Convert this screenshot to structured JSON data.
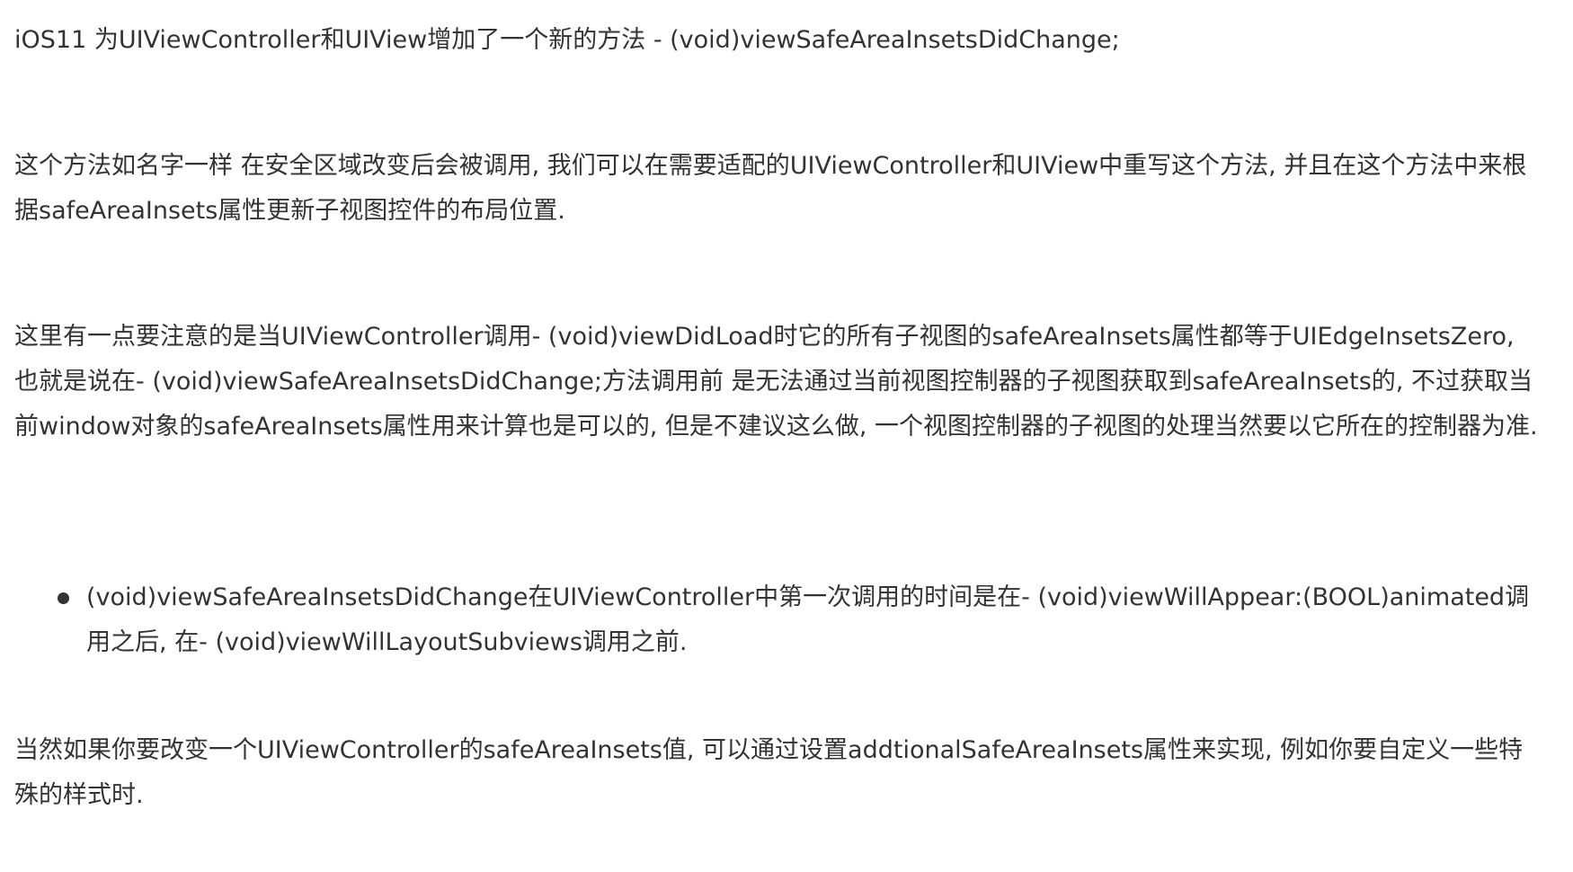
{
  "paragraphs": [
    "iOS11 为UIViewController和UIView增加了一个新的方法 - (void)viewSafeAreaInsetsDidChange;",
    "这个方法如名字一样 在安全区域改变后会被调用, 我们可以在需要适配的UIViewController和UIView中重写这个方法, 并且在这个方法中来根据safeAreaInsets属性更新子视图控件的布局位置.",
    "这里有一点要注意的是当UIViewController调用- (void)viewDidLoad时它的所有子视图的safeAreaInsets属性都等于UIEdgeInsetsZero, 也就是说在- (void)viewSafeAreaInsetsDidChange;方法调用前 是无法通过当前视图控制器的子视图获取到safeAreaInsets的, 不过获取当前window对象的safeAreaInsets属性用来计算也是可以的, 但是不建议这么做, 一个视图控制器的子视图的处理当然要以它所在的控制器为准."
  ],
  "bullets": [
    "(void)viewSafeAreaInsetsDidChange在UIViewController中第一次调用的时间是在- (void)viewWillAppear:(BOOL)animated调用之后, 在- (void)viewWillLayoutSubviews调用之前."
  ],
  "closing_paragraph": "当然如果你要改变一个UIViewController的safeAreaInsets值, 可以通过设置addtionalSafeAreaInsets属性来实现, 例如你要自定义一些特殊的样式时."
}
